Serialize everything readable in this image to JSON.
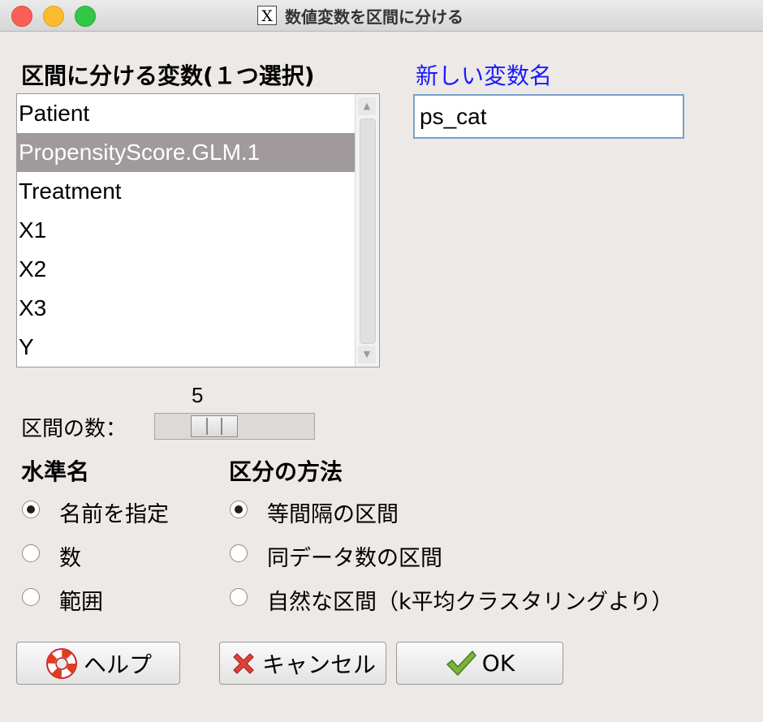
{
  "window": {
    "title": "数値変数を区間に分ける"
  },
  "variables": {
    "label": "区間に分ける変数(１つ選択)",
    "items": [
      "Patient",
      "PropensityScore.GLM.1",
      "Treatment",
      "X1",
      "X2",
      "X3",
      "Y"
    ],
    "selected": "PropensityScore.GLM.1"
  },
  "new_var": {
    "label": "新しい変数名",
    "value": "ps_cat"
  },
  "bins": {
    "label": "区間の数：",
    "value": "5",
    "min": 2,
    "max": 20
  },
  "level_names": {
    "header": "水準名",
    "options": [
      "名前を指定",
      "数",
      "範囲"
    ],
    "selected": "名前を指定"
  },
  "method": {
    "header": "区分の方法",
    "options": [
      "等間隔の区間",
      "同データ数の区間",
      "自然な区間（k平均クラスタリングより）"
    ],
    "selected": "等間隔の区間"
  },
  "buttons": {
    "help": "ヘルプ",
    "cancel": "キャンセル",
    "ok": "OK"
  },
  "colors": {
    "accent_label": "#1a1aff",
    "selection": "#a09a9c"
  }
}
